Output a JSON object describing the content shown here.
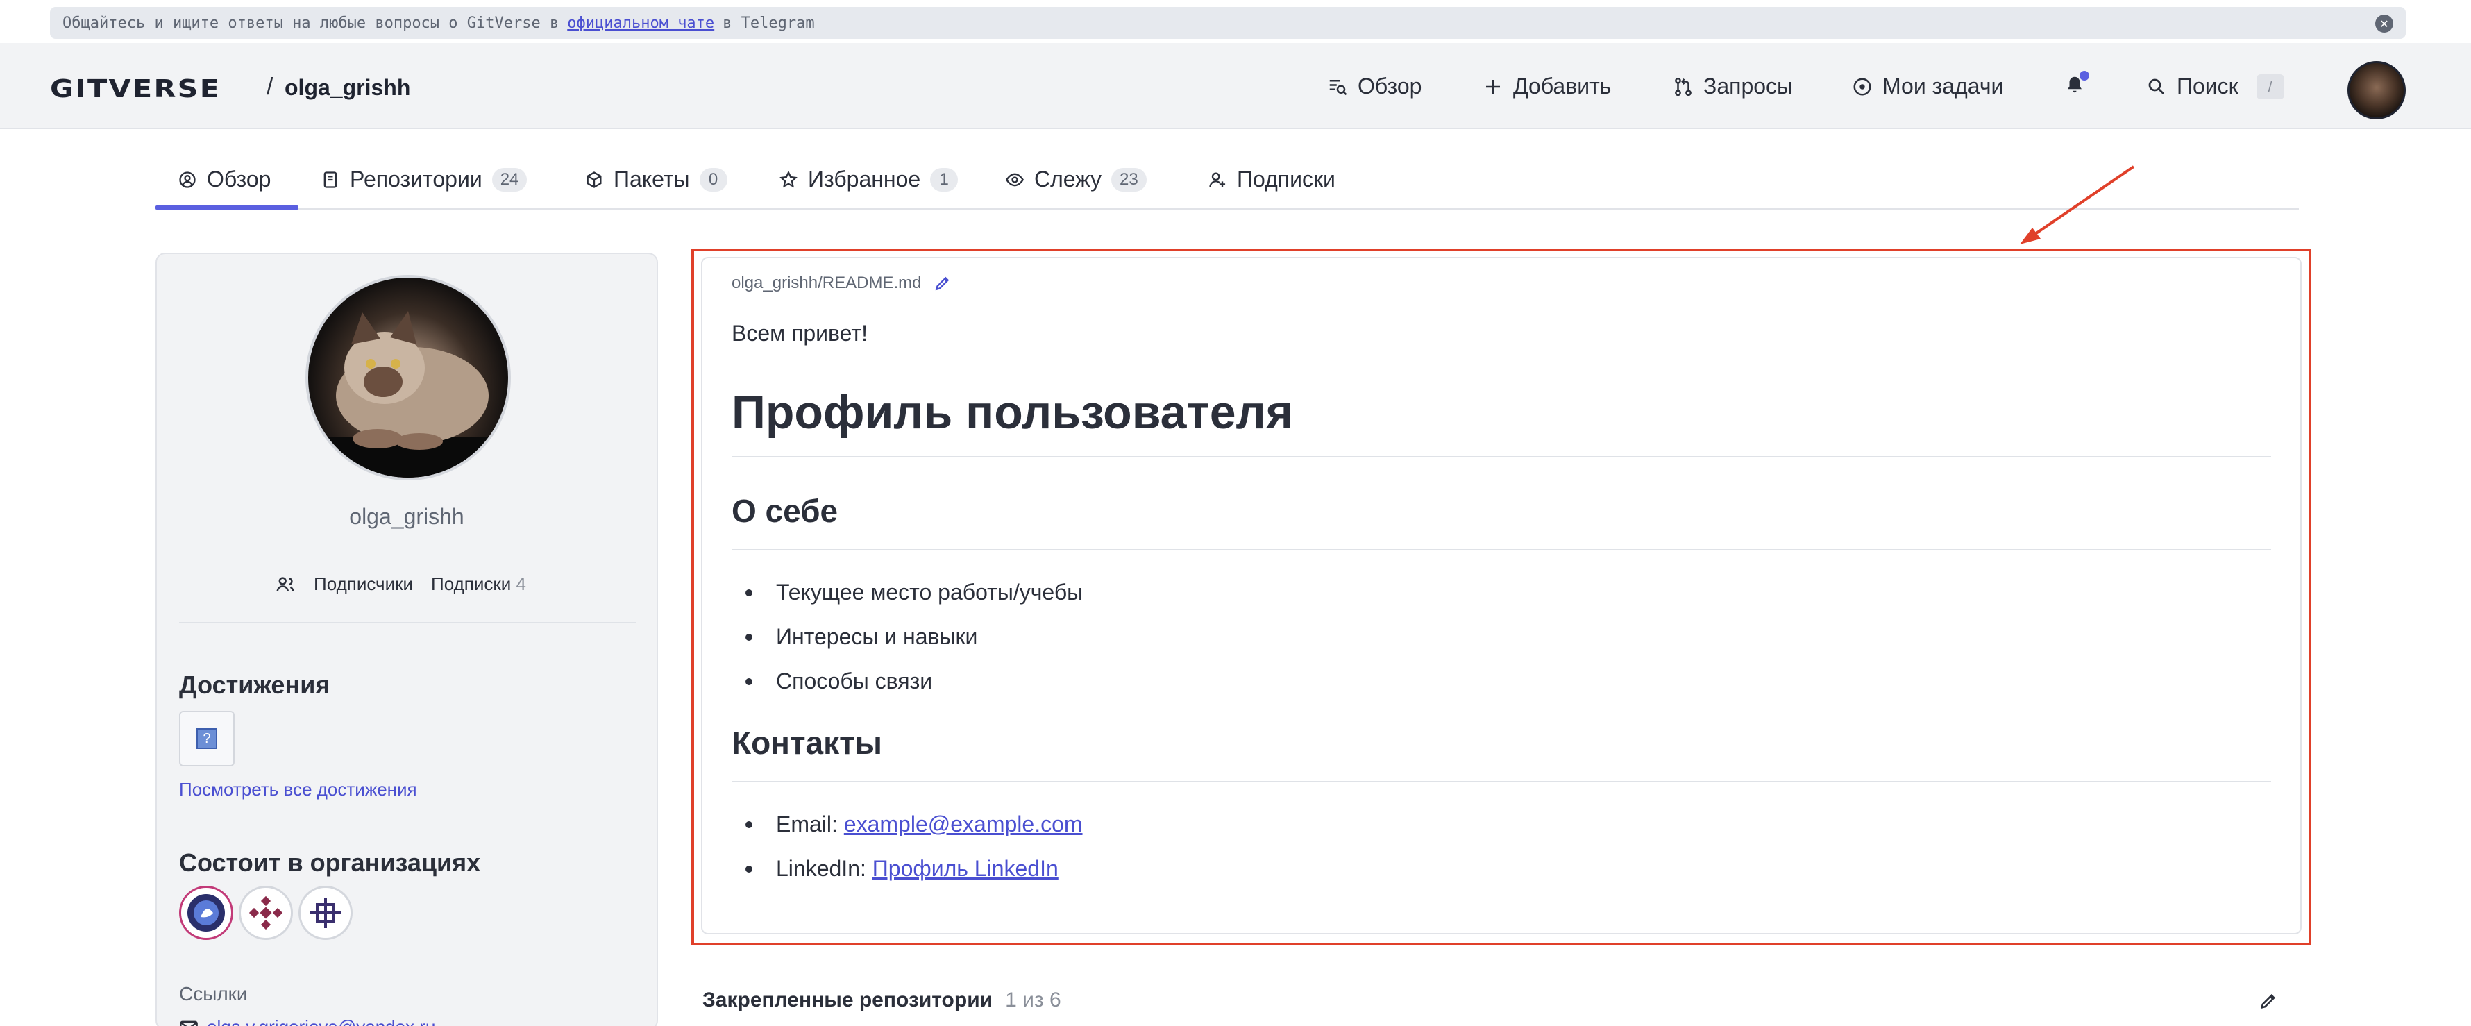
{
  "banner": {
    "text_before": "Общайтесь и ищите ответы на любые вопросы о GitVerse в",
    "link_text": "официальном чате",
    "text_after": "в Telegram",
    "close_icon": "close-icon"
  },
  "header": {
    "logo": "GITVERSE",
    "separator": "/",
    "username": "olga_grishh",
    "nav": {
      "overview": "Обзор",
      "add": "Добавить",
      "requests": "Запросы",
      "tasks": "Мои задачи",
      "search": "Поиск",
      "search_shortcut": "/"
    }
  },
  "tabs": [
    {
      "label": "Обзор",
      "count": ""
    },
    {
      "label": "Репозитории",
      "count": "24"
    },
    {
      "label": "Пакеты",
      "count": "0"
    },
    {
      "label": "Избранное",
      "count": "1"
    },
    {
      "label": "Слежу",
      "count": "23"
    },
    {
      "label": "Подписки",
      "count": ""
    }
  ],
  "sidebar": {
    "name": "olga_grishh",
    "followers_label": "Подписчики",
    "following_label": "Подписки",
    "following_count": "4",
    "achievements_title": "Достижения",
    "achievements_link": "Посмотреть все достижения",
    "orgs_title": "Состоит в организациях",
    "links_label": "Ссылки",
    "links_email": "olga.v.grigorieva@yandex.ru"
  },
  "readme": {
    "path": "olga_grishh/README.md",
    "greeting": "Всем привет!",
    "h1": "Профиль пользователя",
    "about_title": "О себе",
    "about_items": [
      "Текущее место работы/учебы",
      "Интересы и навыки",
      "Способы связи"
    ],
    "contacts_title": "Контакты",
    "email_label": "Email:",
    "email_link": "example@example.com",
    "linkedin_label": "LinkedIn:",
    "linkedin_link": "Профиль LinkedIn"
  },
  "pinned": {
    "title": "Закрепленные репозитории",
    "count": "1 из 6"
  },
  "colors": {
    "accent": "#5a5fe0",
    "highlight": "#e0402a",
    "link": "#4a4fd1"
  }
}
